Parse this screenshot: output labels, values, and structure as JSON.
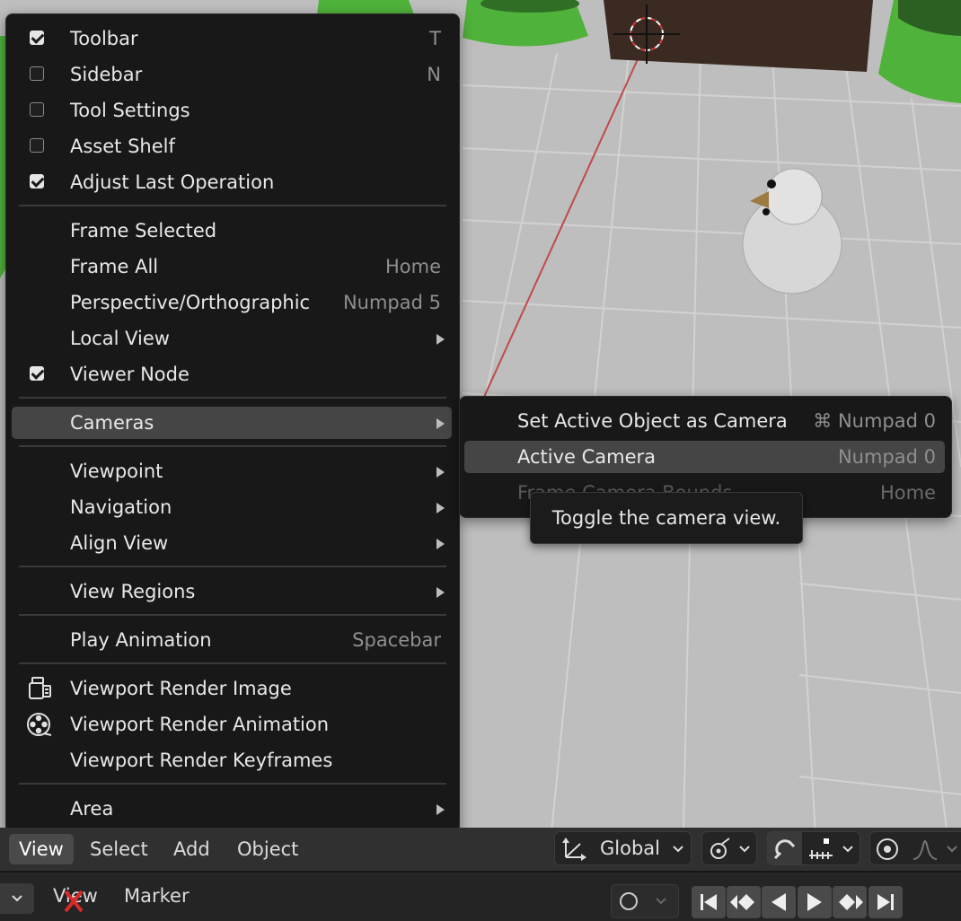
{
  "view_menu": {
    "items": [
      {
        "label": "Toolbar",
        "shortcut": "T",
        "checkbox": true,
        "checked": true
      },
      {
        "label": "Sidebar",
        "shortcut": "N",
        "checkbox": true,
        "checked": false
      },
      {
        "label": "Tool Settings",
        "shortcut": "",
        "checkbox": true,
        "checked": false
      },
      {
        "label": "Asset Shelf",
        "shortcut": "",
        "checkbox": true,
        "checked": false
      },
      {
        "label": "Adjust Last Operation",
        "shortcut": "",
        "checkbox": true,
        "checked": true
      },
      {
        "label": "Frame Selected",
        "shortcut": ""
      },
      {
        "label": "Frame All",
        "shortcut": "Home"
      },
      {
        "label": "Perspective/Orthographic",
        "shortcut": "Numpad 5"
      },
      {
        "label": "Local View",
        "submenu": true
      },
      {
        "label": "Viewer Node",
        "checkbox": true,
        "checked": true
      },
      {
        "label": "Cameras",
        "submenu": true,
        "highlighted": true
      },
      {
        "label": "Viewpoint",
        "submenu": true
      },
      {
        "label": "Navigation",
        "submenu": true
      },
      {
        "label": "Align View",
        "submenu": true
      },
      {
        "label": "View Regions",
        "submenu": true
      },
      {
        "label": "Play Animation",
        "shortcut": "Spacebar"
      },
      {
        "label": "Viewport Render Image",
        "icon": "render-still-icon"
      },
      {
        "label": "Viewport Render Animation",
        "icon": "film-reel-icon"
      },
      {
        "label": "Viewport Render Keyframes"
      },
      {
        "label": "Area",
        "submenu": true
      }
    ]
  },
  "cameras_menu": {
    "items": [
      {
        "label": "Set Active Object as Camera",
        "shortcut": "⌘ Numpad 0"
      },
      {
        "label": "Active Camera",
        "shortcut": "Numpad 0",
        "highlighted": true
      },
      {
        "label": "Frame Camera Bounds",
        "shortcut": "Home",
        "obscured": true
      }
    ]
  },
  "tooltip": {
    "text": "Toggle the camera view."
  },
  "header": {
    "menus": [
      "View",
      "Select",
      "Add",
      "Object"
    ],
    "active_menu": "View",
    "orientation": "Global",
    "icons": [
      "transform-orientation-icon",
      "pivot-icon",
      "snap-magnet-icon",
      "snap-increment-icon",
      "proportional-edit-icon",
      "falloff-icon"
    ]
  },
  "timeline": {
    "menus": [
      "View",
      "Marker"
    ],
    "buttons": [
      "jump-start-icon",
      "prev-keyframe-icon",
      "play-reverse-icon",
      "play-icon",
      "next-keyframe-icon",
      "jump-end-icon"
    ]
  },
  "colors": {
    "menu_bg": "#181818",
    "highlight": "#454545",
    "shortcut_text": "#8f8f8f",
    "viewport_floor": "#bdbdbd",
    "cone_green": "#4fb23a",
    "box_brown": "#3b2a22"
  }
}
